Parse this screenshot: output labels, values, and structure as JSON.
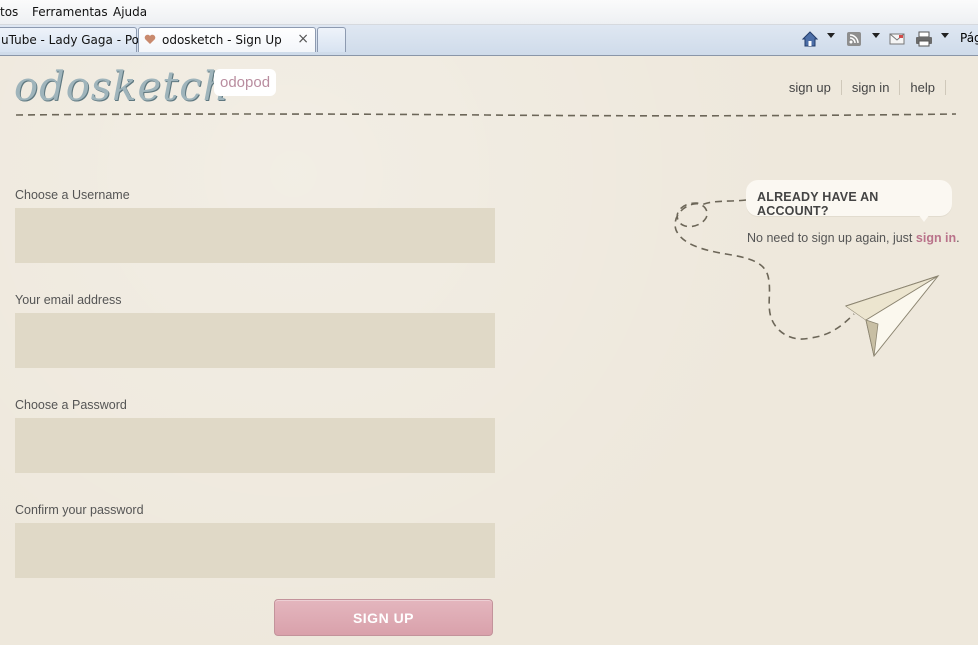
{
  "browser": {
    "menu": [
      "tos",
      "Ferramentas",
      "Ajuda"
    ],
    "tabs": [
      {
        "label": "uTube - Lady Gaga - Po..."
      },
      {
        "label": "odosketch - Sign Up",
        "close": "×"
      }
    ],
    "commandbar": {
      "page_label": "Pág",
      "icons": [
        "home-icon",
        "rss-icon",
        "mail-icon",
        "print-icon"
      ]
    }
  },
  "site": {
    "logo": "odosketch",
    "badge": "odopod",
    "nav": [
      "sign up",
      "sign in",
      "help"
    ]
  },
  "form": {
    "fields": [
      {
        "label": "Choose a Username",
        "value": ""
      },
      {
        "label": "Your email address",
        "value": ""
      },
      {
        "label": "Choose a Password",
        "value": ""
      },
      {
        "label": "Confirm your password",
        "value": ""
      }
    ],
    "submit_label": "SIGN UP"
  },
  "aside": {
    "title": "ALREADY HAVE AN ACCOUNT?",
    "text": "No need to sign up again, just",
    "link": "sign in",
    "trailing": "."
  },
  "colors": {
    "page_bg": "#eee8dc",
    "field_bg": "#e0d9c7",
    "button": "#dca5ae",
    "link": "#b9728a",
    "badge_text": "#b98d9f"
  }
}
